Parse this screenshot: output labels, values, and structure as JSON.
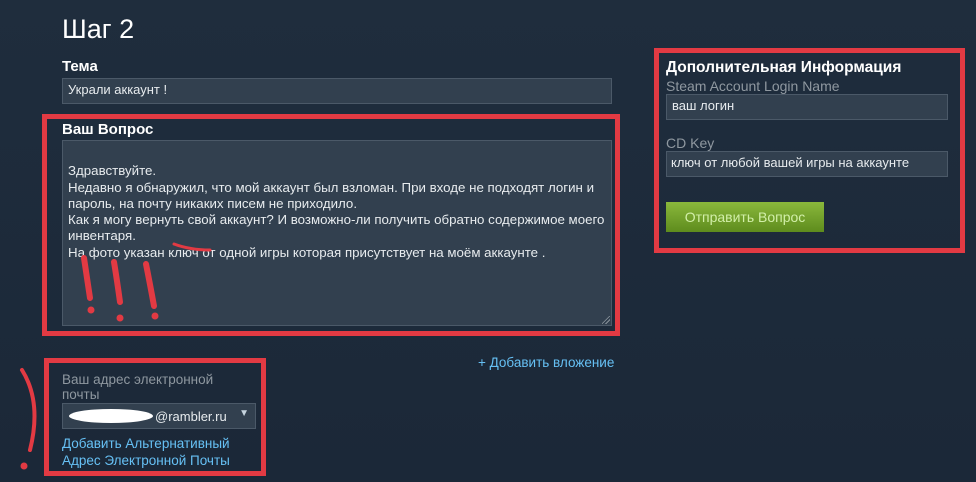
{
  "step": {
    "title": "Шаг 2"
  },
  "subject": {
    "label": "Тема",
    "value": "Украли аккаунт !"
  },
  "question": {
    "label": "Ваш Вопрос",
    "text": "Здравствуйте.\nНедавно я обнаружил, что мой аккаунт был взломан. При входе не подходят логин и пароль, на почту никаких писем не приходило.\nКак я могу вернуть свой аккаунт? И возможно-ли получить обратно содержимое моего инвентаря.\nНа фото указан ключ от одной игры которая присутствует на моём аккаунте ."
  },
  "attachment": {
    "link": "+ Добавить вложение"
  },
  "email": {
    "label": "Ваш адрес электронной почты",
    "selected_domain": "@rambler.ru",
    "alt_link": "Добавить Альтернативный Адрес Электронной Почты"
  },
  "additional": {
    "title": "Дополнительная Информация",
    "login_label": "Steam Account Login Name",
    "login_value": "ваш логин",
    "cdkey_label": "CD Key",
    "cdkey_value": "ключ от любой вашей игры на аккаунте",
    "submit_label": "Отправить Вопрос"
  },
  "colors": {
    "background": "#1b2838",
    "annotation_red": "#e23a43",
    "link": "#66c0f4",
    "button_green": "#6f9f28"
  }
}
